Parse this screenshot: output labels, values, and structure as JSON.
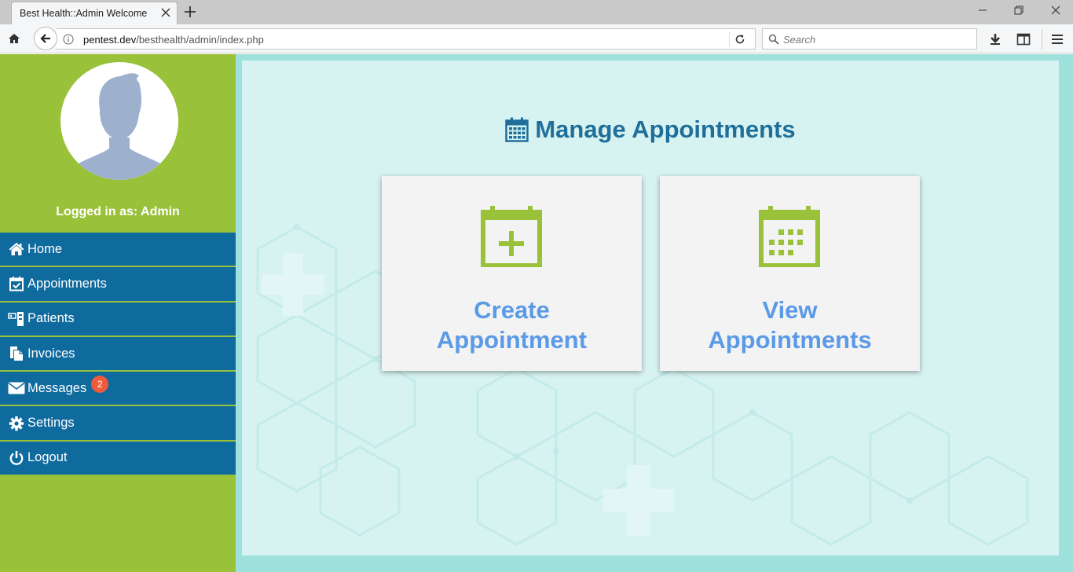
{
  "browser": {
    "tab_title": "Best Health::Admin Welcome",
    "url_host": "pentest.dev",
    "url_path": "/besthealth/admin/index.php",
    "search_placeholder": "Search"
  },
  "sidebar": {
    "logged_in": "Logged in as: Admin",
    "items": [
      {
        "label": "Home",
        "icon": "home-icon"
      },
      {
        "label": "Appointments",
        "icon": "calendar-check-icon"
      },
      {
        "label": "Patients",
        "icon": "patients-icon"
      },
      {
        "label": "Invoices",
        "icon": "invoices-icon"
      },
      {
        "label": "Messages",
        "icon": "envelope-icon",
        "badge": "2"
      },
      {
        "label": "Settings",
        "icon": "gear-icon"
      },
      {
        "label": "Logout",
        "icon": "power-icon"
      }
    ]
  },
  "main": {
    "title": "Manage Appointments",
    "cards": [
      {
        "line1": "Create",
        "line2": "Appointment",
        "icon": "calendar-plus-icon"
      },
      {
        "line1": "View",
        "line2": "Appointments",
        "icon": "calendar-grid-icon"
      }
    ]
  },
  "colors": {
    "sidebar_green": "#9ac13a",
    "menu_blue": "#0f6a9e",
    "title_blue": "#1f6f9a",
    "card_text_blue": "#5b9ae6",
    "badge_red": "#f05a3c"
  }
}
